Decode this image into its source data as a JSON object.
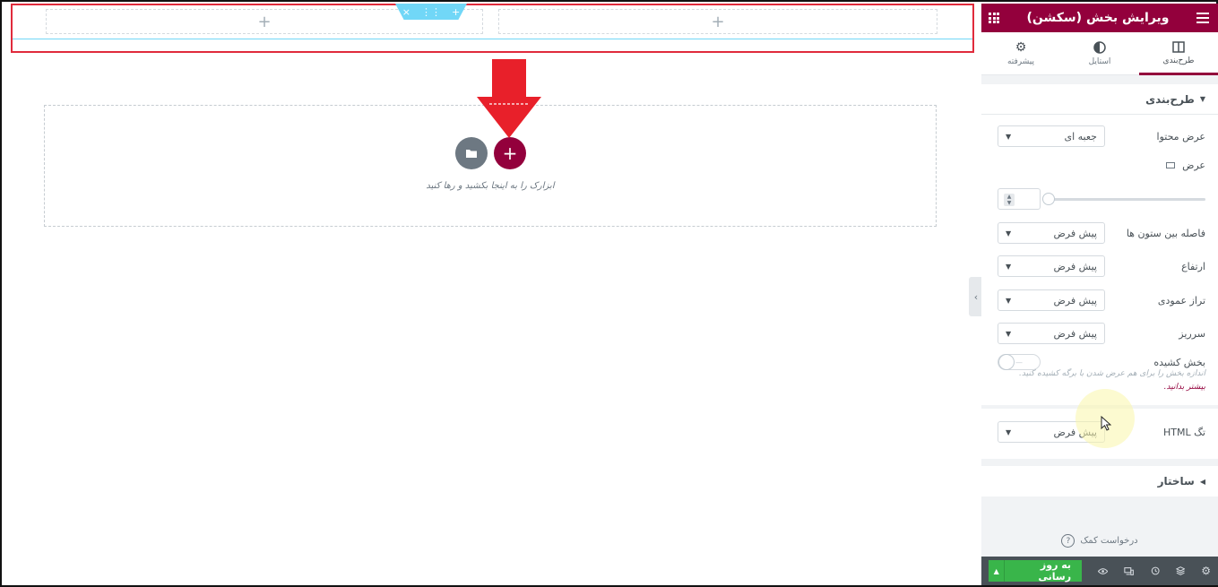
{
  "canvas": {
    "column_add": "+",
    "handle_icons": [
      "+",
      "⋮⋮",
      "×"
    ],
    "add_button": "+",
    "drop_text": "ابزارک را به اینجا بکشید و رها کنید",
    "collapse_icon": "‹"
  },
  "panel": {
    "title": "ویرایش بخش (سکشن)",
    "tabs": [
      {
        "label": "طرح‌بندی",
        "icon": "layout-icon"
      },
      {
        "label": "استایل",
        "icon": "contrast-icon"
      },
      {
        "label": "پیشرفته",
        "icon": "gear-icon"
      }
    ],
    "layout_section": "طرح‌بندی",
    "content_width_label": "عرض محتوا",
    "content_width_value": "جعبه ای",
    "width_label": "عرض",
    "column_gap_label": "فاصله بین ستون ها",
    "column_gap_value": "پیش فرض",
    "height_label": "ارتفاع",
    "height_value": "پیش فرض",
    "vertical_align_label": "تراز عمودی",
    "vertical_align_value": "پیش فرض",
    "overflow_label": "سرریز",
    "overflow_value": "پیش فرض",
    "stretch_label": "بخش کشیده",
    "stretch_hint": "اندازه بخش را برای هم عرض شدن با برگه کشیده کنید.",
    "stretch_link": "بیشتر بدانید.",
    "html_tag_label": "تگ HTML",
    "html_tag_value": "پیش فرض",
    "structure_section": "ساختار",
    "help_text": "درخواست کمک",
    "publish_label": "به روز رسانی"
  },
  "colors": {
    "brand": "#93003c",
    "section_border": "#e02b3c",
    "handle": "#71d7f7",
    "publish": "#39b54a"
  }
}
